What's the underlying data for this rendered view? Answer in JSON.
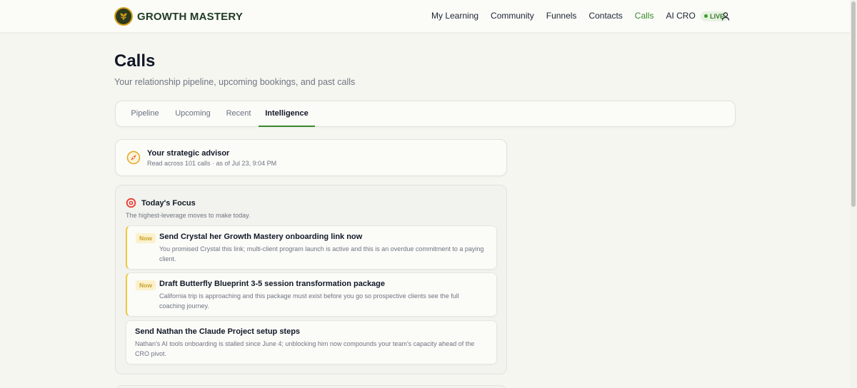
{
  "header": {
    "brand_name": "GROWTH MASTERY",
    "nav": [
      {
        "label": "My Learning"
      },
      {
        "label": "Community"
      },
      {
        "label": "Funnels"
      },
      {
        "label": "Contacts"
      },
      {
        "label": "Calls"
      },
      {
        "label": "AI CRO"
      }
    ],
    "live_badge": "LIVE",
    "active_nav": "Calls"
  },
  "page": {
    "title": "Calls",
    "subtitle": "Your relationship pipeline, upcoming bookings, and past calls"
  },
  "tabs": [
    {
      "label": "Pipeline"
    },
    {
      "label": "Upcoming"
    },
    {
      "label": "Recent"
    },
    {
      "label": "Intelligence"
    }
  ],
  "active_tab": "Intelligence",
  "advisor": {
    "title": "Your strategic advisor",
    "meta": "Read across 101 calls · as of Jul 23, 9:04 PM"
  },
  "focus": {
    "title": "Today's Focus",
    "subtitle": "The highest-leverage moves to make today.",
    "items": [
      {
        "badge": "Now",
        "title": "Send Crystal her Growth Mastery onboarding link now",
        "description": "You promised Crystal this link; multi-client program launch is active and this is an overdue commitment to a paying client."
      },
      {
        "badge": "Now",
        "title": "Draft Butterfly Blueprint 3-5 session transformation package",
        "description": "California trip is approaching and this package must exist before you go so prospective clients see the full coaching journey."
      },
      {
        "badge": "",
        "title": "Send Nathan the Claude Project setup steps",
        "description": "Nathan's AI tools onboarding is stalled since June 4; unblocking him now compounds your team's capacity ahead of the CRO pivot."
      }
    ]
  },
  "colors": {
    "accent_green": "#3a8a2b",
    "brand_dark": "#1f3b21",
    "now_yellow": "#f0c93a",
    "background": "#f6f6f1"
  },
  "icons": {
    "logo": "growth-leaf-icon",
    "user": "user-icon",
    "advisor": "compass-icon",
    "focus": "target-icon"
  }
}
